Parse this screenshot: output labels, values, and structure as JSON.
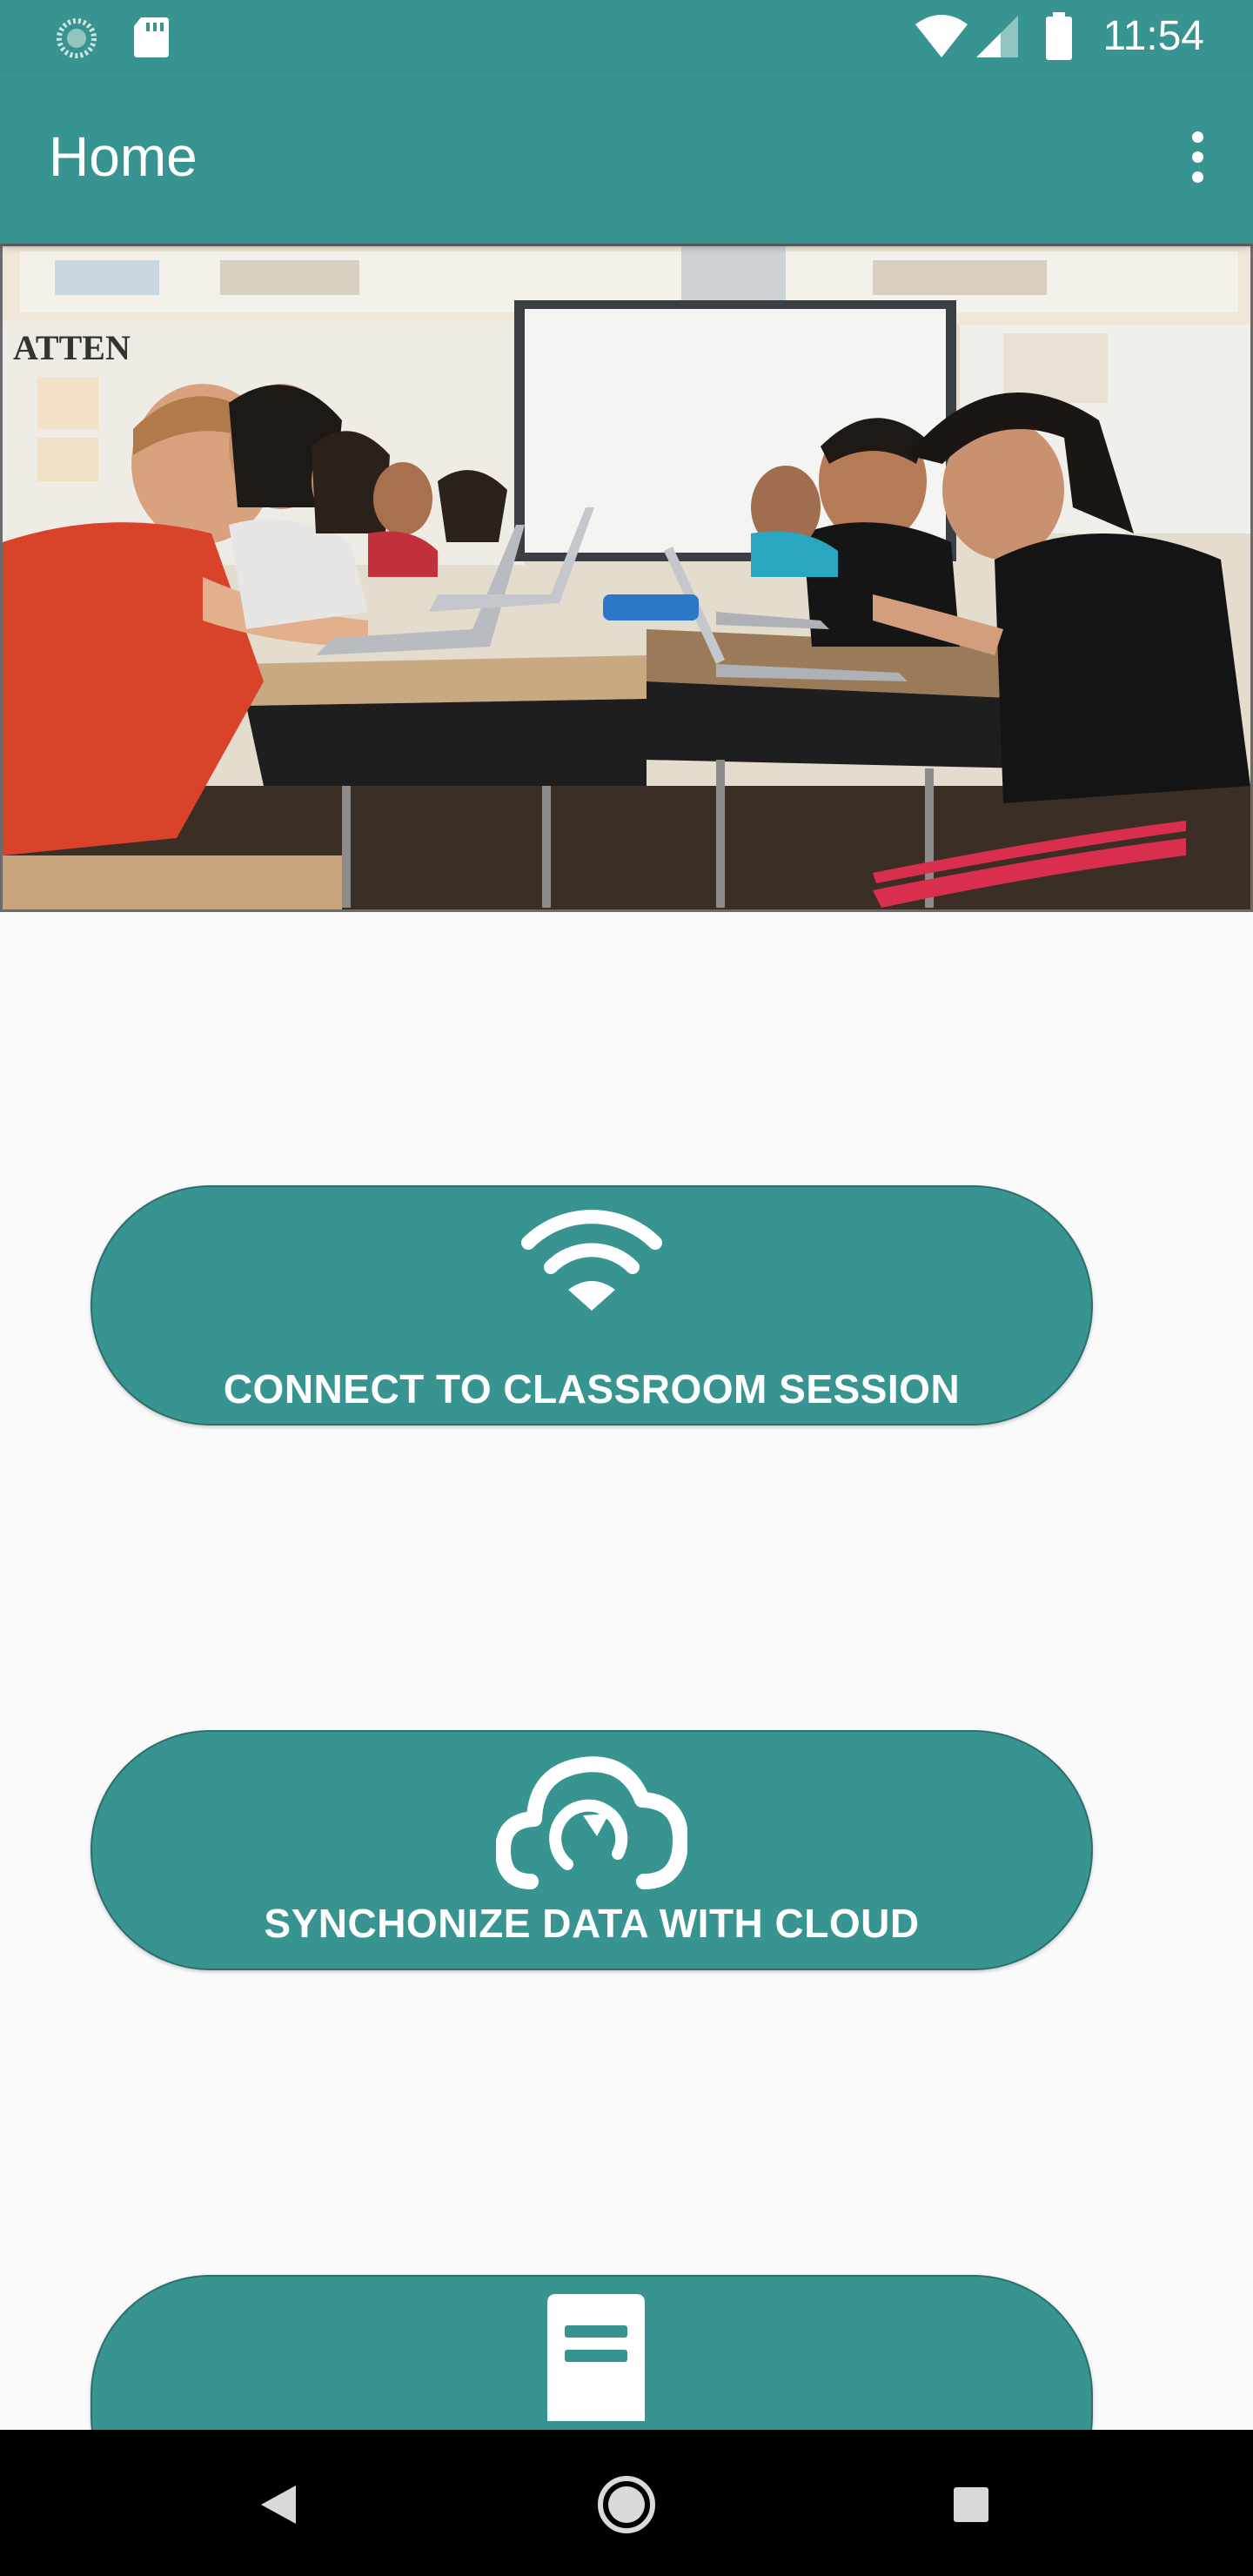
{
  "status_bar": {
    "time": "11:54",
    "icons": [
      "sync-spinner-icon",
      "sd-card-icon",
      "wifi-signal-icon",
      "cell-signal-icon",
      "battery-icon"
    ]
  },
  "app_bar": {
    "title": "Home",
    "menu_icon": "more-vert-icon"
  },
  "hero": {
    "image_icon": "classroom-photo"
  },
  "actions": [
    {
      "label": "CONNECT TO CLASSROOM SESSION",
      "icon": "wifi-icon"
    },
    {
      "label": "SYNCHONIZE DATA WITH CLOUD",
      "icon": "cloud-sync-icon"
    },
    {
      "label": "",
      "icon": "document-icon"
    }
  ],
  "nav_bar": {
    "icons": [
      "back-icon",
      "home-icon",
      "recents-icon"
    ]
  },
  "colors": {
    "primary": "#379490",
    "background": "#fafafa",
    "nav_bar": "#000000",
    "on_primary": "#ffffff"
  }
}
